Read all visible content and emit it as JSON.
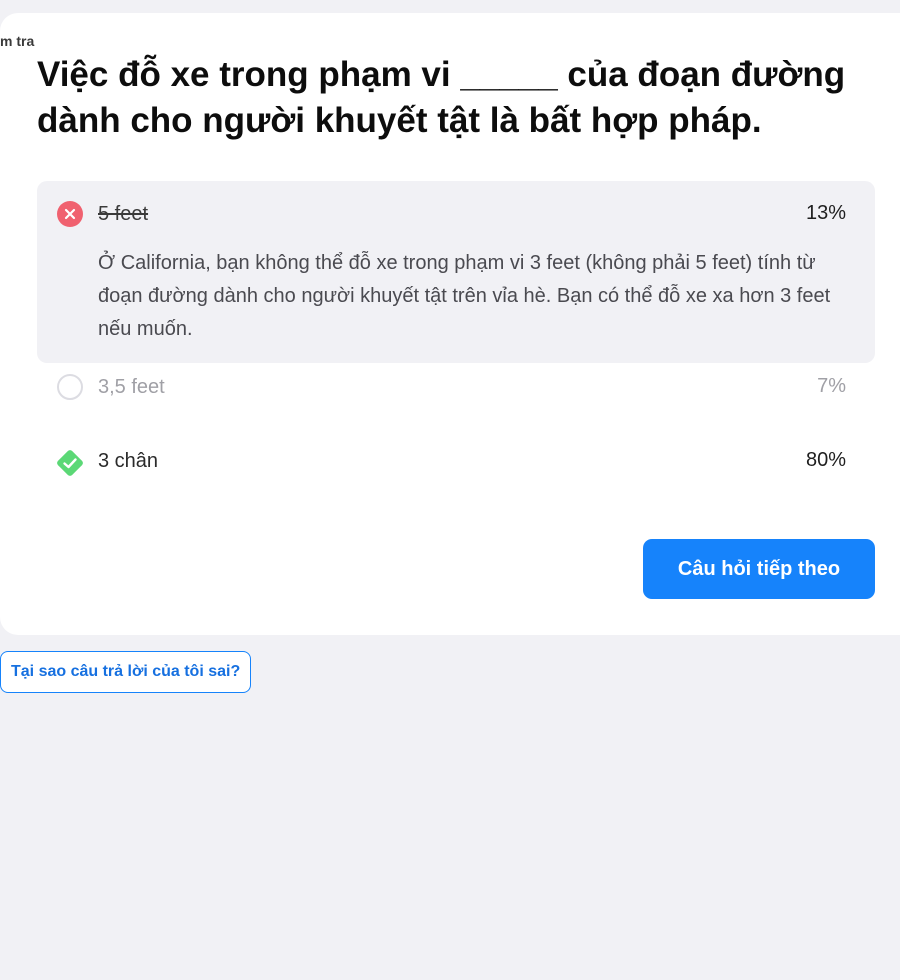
{
  "breadcrumb": "m tra",
  "question": "Việc đỗ xe trong phạm vi _____ của đoạn đường dành cho người khuyết tật là bất hợp pháp.",
  "answers": [
    {
      "label": "5 feet",
      "percent": "13%",
      "state": "selected-wrong",
      "explanation": "Ở California, bạn không thể đỗ xe trong phạm vi 3 feet (không phải 5 feet) tính từ đoạn đường dành cho người khuyết tật trên vỉa hè. Bạn có thể đỗ xe xa hơn 3 feet nếu muốn."
    },
    {
      "label": "3,5 feet",
      "percent": "7%",
      "state": "unselected"
    },
    {
      "label": "3 chân",
      "percent": "80%",
      "state": "correct"
    }
  ],
  "buttons": {
    "next": "Câu hỏi tiếp theo",
    "why_wrong": "Tại sao câu trả lời của tôi sai?"
  },
  "colors": {
    "page_background": "#f1f1f5",
    "card_background": "#ffffff",
    "primary": "#1683fb",
    "wrong": "#f0616f",
    "correct": "#5bd876",
    "muted_text": "#a0a0a6"
  },
  "icons": {
    "wrong": "x-circle-icon",
    "unselected": "empty-circle-icon",
    "correct": "check-diamond-icon"
  }
}
